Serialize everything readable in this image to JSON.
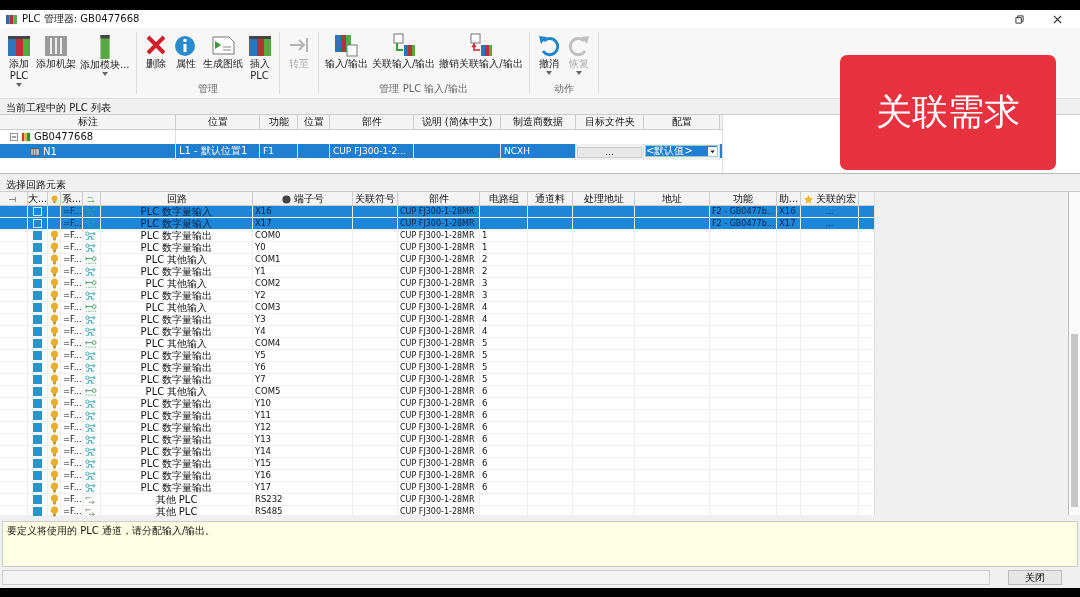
{
  "window": {
    "title": "PLC 管理器: GB0477668"
  },
  "ribbon": {
    "groups": [
      {
        "buttons": [
          {
            "label": "添加\nPLC",
            "kind": "plc",
            "disabled": false,
            "dropdown": true
          },
          {
            "label": "添加机架",
            "kind": "rack",
            "disabled": false,
            "dropdown": false
          },
          {
            "label": "添加模块...",
            "kind": "module",
            "disabled": false,
            "dropdown": true
          }
        ]
      },
      {
        "label": "管理",
        "buttons": [
          {
            "label": "删除",
            "kind": "delete",
            "disabled": false,
            "dropdown": false
          },
          {
            "label": "属性",
            "kind": "properties",
            "disabled": false,
            "dropdown": false
          },
          {
            "label": "生成图纸",
            "kind": "drawing",
            "disabled": false,
            "dropdown": false
          },
          {
            "label": "插入\nPLC",
            "kind": "plc",
            "disabled": false,
            "dropdown": false
          }
        ]
      },
      {
        "buttons": [
          {
            "label": "转至",
            "kind": "goto",
            "disabled": true,
            "dropdown": false
          }
        ]
      },
      {
        "label": "管理 PLC 输入/输出",
        "buttons": [
          {
            "label": "输入/输出",
            "kind": "io",
            "disabled": false,
            "dropdown": false
          },
          {
            "label": "关联输入/输出",
            "kind": "link_io",
            "disabled": false,
            "dropdown": false
          },
          {
            "label": "撤销关联输入/输出",
            "kind": "unlink_io",
            "disabled": false,
            "dropdown": false
          }
        ]
      },
      {
        "label": "动作",
        "buttons": [
          {
            "label": "撤消",
            "kind": "undo",
            "disabled": false,
            "dropdown": true
          },
          {
            "label": "恢复",
            "kind": "redo",
            "disabled": true,
            "dropdown": true
          }
        ]
      }
    ]
  },
  "plc_list": {
    "title": "当前工程中的 PLC 列表",
    "columns": [
      "标注",
      "位置",
      "功能",
      "位置",
      "部件",
      "说明 (简体中文)",
      "制造商数据",
      "目标文件夹",
      "配置"
    ],
    "tree": [
      {
        "label": "GB0477668",
        "expanded": true,
        "children": [
          {
            "label": "N1",
            "selected": true,
            "location": "L1 - 默认位置1",
            "function": "F1",
            "part": "CUP FJ300-1-2...",
            "manufacturer": "NCXH",
            "target_folder": "...",
            "config": "<默认值>"
          }
        ]
      }
    ]
  },
  "circuit_list": {
    "title": "选择回路元素",
    "columns": [
      {
        "kind": "pin"
      },
      {
        "label": "大..."
      },
      {
        "kind": "bulb"
      },
      {
        "label": "系..."
      },
      {
        "kind": "circuit"
      },
      {
        "label": "回路"
      },
      {
        "label": "端子号",
        "kind": "dot"
      },
      {
        "label": "关联符号"
      },
      {
        "label": "部件"
      },
      {
        "label": "电路组"
      },
      {
        "label": "通道料"
      },
      {
        "label": "处理地址"
      },
      {
        "label": "地址"
      },
      {
        "label": "功能"
      },
      {
        "label": "助..."
      },
      {
        "label": "关联的宏",
        "kind": "star"
      }
    ],
    "rows": [
      {
        "selected": true,
        "system": "=F...",
        "kind": "input",
        "circuit": "PLC 数字量输入",
        "terminal": "X16",
        "part": "CUP FJ300-1-28MR",
        "function": "F2 - GB0477b...",
        "aux": "X16",
        "macro": "..."
      },
      {
        "selected": true,
        "system": "=F...",
        "kind": "input",
        "circuit": "PLC 数字量输入",
        "terminal": "X17",
        "part": "CUP FJ300-1-28MR",
        "function": "F2 - GB0477b...",
        "aux": "X17",
        "macro": "..."
      },
      {
        "selected": false,
        "system": "=F...",
        "kind": "output",
        "circuit": "PLC 数字量输出",
        "terminal": "COM0",
        "part": "CUP FJ300-1-28MR",
        "group": "1"
      },
      {
        "selected": false,
        "system": "=F...",
        "kind": "output",
        "circuit": "PLC 数字量输出",
        "terminal": "Y0",
        "part": "CUP FJ300-1-28MR",
        "group": "1"
      },
      {
        "selected": false,
        "system": "=F...",
        "kind": "other_input",
        "circuit": "PLC 其他输入",
        "terminal": "COM1",
        "part": "CUP FJ300-1-28MR",
        "group": "2"
      },
      {
        "selected": false,
        "system": "=F...",
        "kind": "output",
        "circuit": "PLC 数字量输出",
        "terminal": "Y1",
        "part": "CUP FJ300-1-28MR",
        "group": "2"
      },
      {
        "selected": false,
        "system": "=F...",
        "kind": "other_input",
        "circuit": "PLC 其他输入",
        "terminal": "COM2",
        "part": "CUP FJ300-1-28MR",
        "group": "3"
      },
      {
        "selected": false,
        "system": "=F...",
        "kind": "output",
        "circuit": "PLC 数字量输出",
        "terminal": "Y2",
        "part": "CUP FJ300-1-28MR",
        "group": "3"
      },
      {
        "selected": false,
        "system": "=F...",
        "kind": "other_input",
        "circuit": "PLC 其他输入",
        "terminal": "COM3",
        "part": "CUP FJ300-1-28MR",
        "group": "4"
      },
      {
        "selected": false,
        "system": "=F...",
        "kind": "output",
        "circuit": "PLC 数字量输出",
        "terminal": "Y3",
        "part": "CUP FJ300-1-28MR",
        "group": "4"
      },
      {
        "selected": false,
        "system": "=F...",
        "kind": "output",
        "circuit": "PLC 数字量输出",
        "terminal": "Y4",
        "part": "CUP FJ300-1-28MR",
        "group": "4"
      },
      {
        "selected": false,
        "system": "=F...",
        "kind": "other_input",
        "circuit": "PLC 其他输入",
        "terminal": "COM4",
        "part": "CUP FJ300-1-28MR",
        "group": "5"
      },
      {
        "selected": false,
        "system": "=F...",
        "kind": "output",
        "circuit": "PLC 数字量输出",
        "terminal": "Y5",
        "part": "CUP FJ300-1-28MR",
        "group": "5"
      },
      {
        "selected": false,
        "system": "=F...",
        "kind": "output",
        "circuit": "PLC 数字量输出",
        "terminal": "Y6",
        "part": "CUP FJ300-1-28MR",
        "group": "5"
      },
      {
        "selected": false,
        "system": "=F...",
        "kind": "output",
        "circuit": "PLC 数字量输出",
        "terminal": "Y7",
        "part": "CUP FJ300-1-28MR",
        "group": "5"
      },
      {
        "selected": false,
        "system": "=F...",
        "kind": "other_input",
        "circuit": "PLC 其他输入",
        "terminal": "COM5",
        "part": "CUP FJ300-1-28MR",
        "group": "6"
      },
      {
        "selected": false,
        "system": "=F...",
        "kind": "output",
        "circuit": "PLC 数字量输出",
        "terminal": "Y10",
        "part": "CUP FJ300-1-28MR",
        "group": "6"
      },
      {
        "selected": false,
        "system": "=F...",
        "kind": "output",
        "circuit": "PLC 数字量输出",
        "terminal": "Y11",
        "part": "CUP FJ300-1-28MR",
        "group": "6"
      },
      {
        "selected": false,
        "system": "=F...",
        "kind": "output",
        "circuit": "PLC 数字量输出",
        "terminal": "Y12",
        "part": "CUP FJ300-1-28MR",
        "group": "6"
      },
      {
        "selected": false,
        "system": "=F...",
        "kind": "output",
        "circuit": "PLC 数字量输出",
        "terminal": "Y13",
        "part": "CUP FJ300-1-28MR",
        "group": "6"
      },
      {
        "selected": false,
        "system": "=F...",
        "kind": "output",
        "circuit": "PLC 数字量输出",
        "terminal": "Y14",
        "part": "CUP FJ300-1-28MR",
        "group": "6"
      },
      {
        "selected": false,
        "system": "=F...",
        "kind": "output",
        "circuit": "PLC 数字量输出",
        "terminal": "Y15",
        "part": "CUP FJ300-1-28MR",
        "group": "6"
      },
      {
        "selected": false,
        "system": "=F...",
        "kind": "output",
        "circuit": "PLC 数字量输出",
        "terminal": "Y16",
        "part": "CUP FJ300-1-28MR",
        "group": "6"
      },
      {
        "selected": false,
        "system": "=F...",
        "kind": "output",
        "circuit": "PLC 数字量输出",
        "terminal": "Y17",
        "part": "CUP FJ300-1-28MR",
        "group": "6"
      },
      {
        "selected": false,
        "system": "=F...",
        "kind": "other",
        "circuit": "其他 PLC",
        "terminal": "RS232",
        "part": "CUP FJ300-1-28MR"
      },
      {
        "selected": false,
        "system": "=F...",
        "kind": "other",
        "circuit": "其他 PLC",
        "terminal": "RS485",
        "part": "CUP FJ300-1-28MR"
      }
    ]
  },
  "hint": "要定义将使用的 PLC 通道，请分配输入/输出。",
  "close_button": "关闭",
  "overlays": {
    "callout": "关联需求"
  }
}
